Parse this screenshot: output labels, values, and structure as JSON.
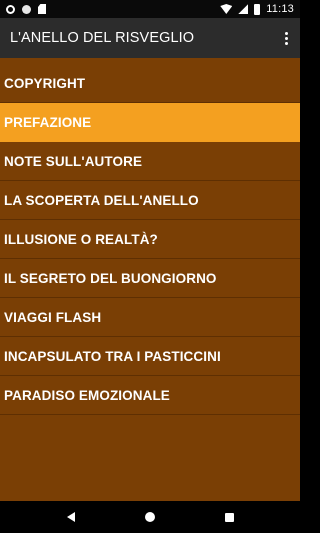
{
  "status_bar": {
    "time": "11:13",
    "icons": [
      "gear-icon",
      "circle-icon",
      "sd-card-icon",
      "wifi-icon",
      "signal-icon",
      "battery-icon"
    ]
  },
  "app_bar": {
    "title": "L'ANELLO DEL RISVEGLIO",
    "overflow_icon": "more-vert-icon"
  },
  "menu": {
    "selected_index": 1,
    "items": [
      {
        "label": "COPYRIGHT"
      },
      {
        "label": "PREFAZIONE"
      },
      {
        "label": "NOTE SULL'AUTORE"
      },
      {
        "label": "LA SCOPERTA DELL'ANELLO"
      },
      {
        "label": "ILLUSIONE O REALTÀ?"
      },
      {
        "label": "IL SEGRETO DEL BUONGIORNO"
      },
      {
        "label": "VIAGGI FLASH"
      },
      {
        "label": "INCAPSULATO TRA I PASTICCINI"
      },
      {
        "label": "PARADISO EMOZIONALE"
      }
    ]
  },
  "colors": {
    "list_background": "#7a3f05",
    "selected_background": "#f4a020",
    "app_bar_background": "#2c2c2c"
  },
  "nav_bar": {
    "icons": [
      "back-icon",
      "home-icon",
      "recents-icon"
    ]
  }
}
